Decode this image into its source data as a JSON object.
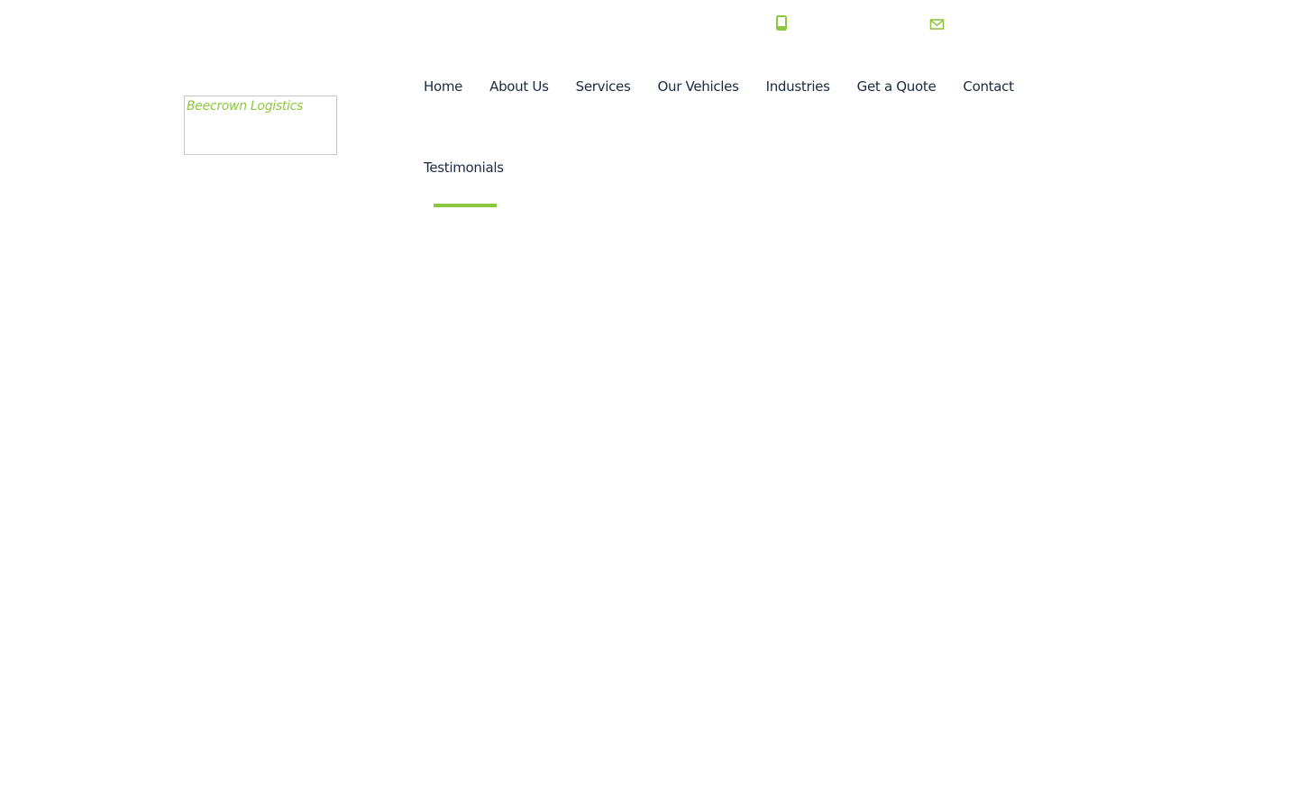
{
  "brand": {
    "logo_text": "Beecrown Logistics",
    "accent_color": "#8dc63f",
    "text_color": "#1b2a41"
  },
  "topbar": {
    "icons": [
      "phone-icon",
      "mail-icon"
    ]
  },
  "nav": {
    "items": [
      {
        "label": "Home"
      },
      {
        "label": "About Us"
      },
      {
        "label": "Services"
      },
      {
        "label": "Our Vehicles"
      },
      {
        "label": "Industries"
      },
      {
        "label": "Get a Quote"
      },
      {
        "label": "Contact"
      },
      {
        "label": "Testimonials"
      }
    ]
  }
}
